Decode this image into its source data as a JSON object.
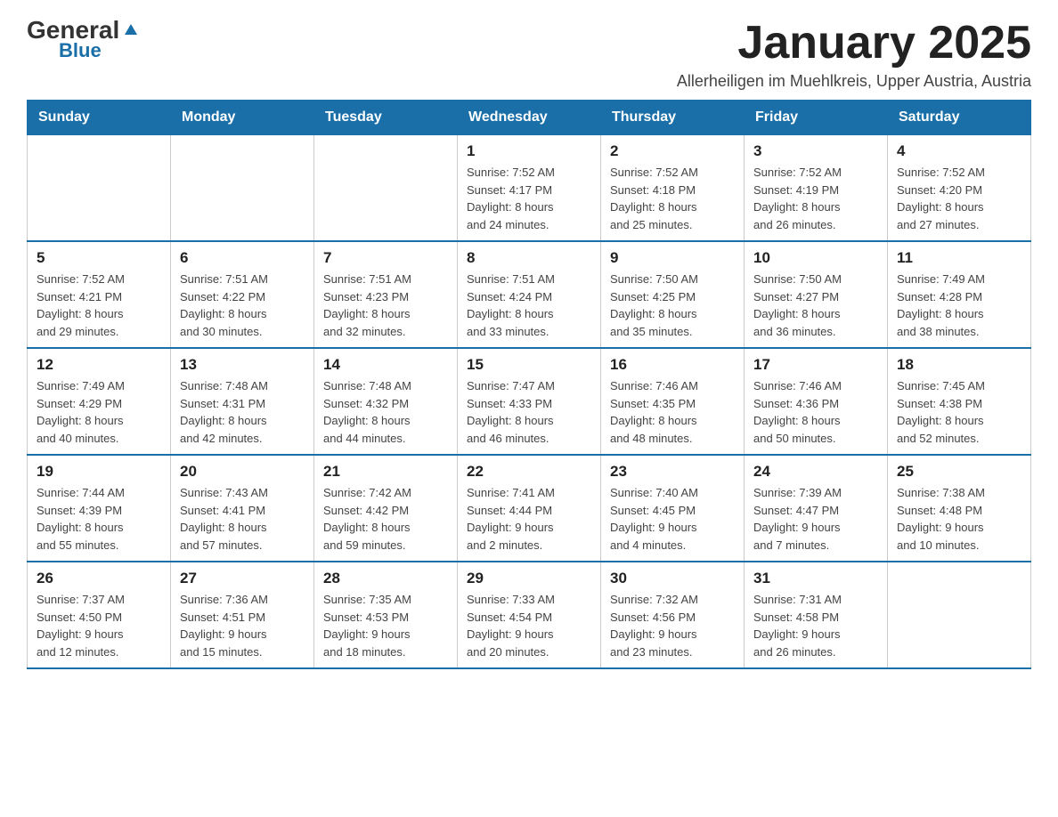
{
  "logo": {
    "general": "General",
    "triangle": "▲",
    "blue": "Blue"
  },
  "header": {
    "month_title": "January 2025",
    "subtitle": "Allerheiligen im Muehlkreis, Upper Austria, Austria"
  },
  "days_of_week": [
    "Sunday",
    "Monday",
    "Tuesday",
    "Wednesday",
    "Thursday",
    "Friday",
    "Saturday"
  ],
  "weeks": [
    [
      {
        "day": "",
        "info": ""
      },
      {
        "day": "",
        "info": ""
      },
      {
        "day": "",
        "info": ""
      },
      {
        "day": "1",
        "info": "Sunrise: 7:52 AM\nSunset: 4:17 PM\nDaylight: 8 hours\nand 24 minutes."
      },
      {
        "day": "2",
        "info": "Sunrise: 7:52 AM\nSunset: 4:18 PM\nDaylight: 8 hours\nand 25 minutes."
      },
      {
        "day": "3",
        "info": "Sunrise: 7:52 AM\nSunset: 4:19 PM\nDaylight: 8 hours\nand 26 minutes."
      },
      {
        "day": "4",
        "info": "Sunrise: 7:52 AM\nSunset: 4:20 PM\nDaylight: 8 hours\nand 27 minutes."
      }
    ],
    [
      {
        "day": "5",
        "info": "Sunrise: 7:52 AM\nSunset: 4:21 PM\nDaylight: 8 hours\nand 29 minutes."
      },
      {
        "day": "6",
        "info": "Sunrise: 7:51 AM\nSunset: 4:22 PM\nDaylight: 8 hours\nand 30 minutes."
      },
      {
        "day": "7",
        "info": "Sunrise: 7:51 AM\nSunset: 4:23 PM\nDaylight: 8 hours\nand 32 minutes."
      },
      {
        "day": "8",
        "info": "Sunrise: 7:51 AM\nSunset: 4:24 PM\nDaylight: 8 hours\nand 33 minutes."
      },
      {
        "day": "9",
        "info": "Sunrise: 7:50 AM\nSunset: 4:25 PM\nDaylight: 8 hours\nand 35 minutes."
      },
      {
        "day": "10",
        "info": "Sunrise: 7:50 AM\nSunset: 4:27 PM\nDaylight: 8 hours\nand 36 minutes."
      },
      {
        "day": "11",
        "info": "Sunrise: 7:49 AM\nSunset: 4:28 PM\nDaylight: 8 hours\nand 38 minutes."
      }
    ],
    [
      {
        "day": "12",
        "info": "Sunrise: 7:49 AM\nSunset: 4:29 PM\nDaylight: 8 hours\nand 40 minutes."
      },
      {
        "day": "13",
        "info": "Sunrise: 7:48 AM\nSunset: 4:31 PM\nDaylight: 8 hours\nand 42 minutes."
      },
      {
        "day": "14",
        "info": "Sunrise: 7:48 AM\nSunset: 4:32 PM\nDaylight: 8 hours\nand 44 minutes."
      },
      {
        "day": "15",
        "info": "Sunrise: 7:47 AM\nSunset: 4:33 PM\nDaylight: 8 hours\nand 46 minutes."
      },
      {
        "day": "16",
        "info": "Sunrise: 7:46 AM\nSunset: 4:35 PM\nDaylight: 8 hours\nand 48 minutes."
      },
      {
        "day": "17",
        "info": "Sunrise: 7:46 AM\nSunset: 4:36 PM\nDaylight: 8 hours\nand 50 minutes."
      },
      {
        "day": "18",
        "info": "Sunrise: 7:45 AM\nSunset: 4:38 PM\nDaylight: 8 hours\nand 52 minutes."
      }
    ],
    [
      {
        "day": "19",
        "info": "Sunrise: 7:44 AM\nSunset: 4:39 PM\nDaylight: 8 hours\nand 55 minutes."
      },
      {
        "day": "20",
        "info": "Sunrise: 7:43 AM\nSunset: 4:41 PM\nDaylight: 8 hours\nand 57 minutes."
      },
      {
        "day": "21",
        "info": "Sunrise: 7:42 AM\nSunset: 4:42 PM\nDaylight: 8 hours\nand 59 minutes."
      },
      {
        "day": "22",
        "info": "Sunrise: 7:41 AM\nSunset: 4:44 PM\nDaylight: 9 hours\nand 2 minutes."
      },
      {
        "day": "23",
        "info": "Sunrise: 7:40 AM\nSunset: 4:45 PM\nDaylight: 9 hours\nand 4 minutes."
      },
      {
        "day": "24",
        "info": "Sunrise: 7:39 AM\nSunset: 4:47 PM\nDaylight: 9 hours\nand 7 minutes."
      },
      {
        "day": "25",
        "info": "Sunrise: 7:38 AM\nSunset: 4:48 PM\nDaylight: 9 hours\nand 10 minutes."
      }
    ],
    [
      {
        "day": "26",
        "info": "Sunrise: 7:37 AM\nSunset: 4:50 PM\nDaylight: 9 hours\nand 12 minutes."
      },
      {
        "day": "27",
        "info": "Sunrise: 7:36 AM\nSunset: 4:51 PM\nDaylight: 9 hours\nand 15 minutes."
      },
      {
        "day": "28",
        "info": "Sunrise: 7:35 AM\nSunset: 4:53 PM\nDaylight: 9 hours\nand 18 minutes."
      },
      {
        "day": "29",
        "info": "Sunrise: 7:33 AM\nSunset: 4:54 PM\nDaylight: 9 hours\nand 20 minutes."
      },
      {
        "day": "30",
        "info": "Sunrise: 7:32 AM\nSunset: 4:56 PM\nDaylight: 9 hours\nand 23 minutes."
      },
      {
        "day": "31",
        "info": "Sunrise: 7:31 AM\nSunset: 4:58 PM\nDaylight: 9 hours\nand 26 minutes."
      },
      {
        "day": "",
        "info": ""
      }
    ]
  ]
}
